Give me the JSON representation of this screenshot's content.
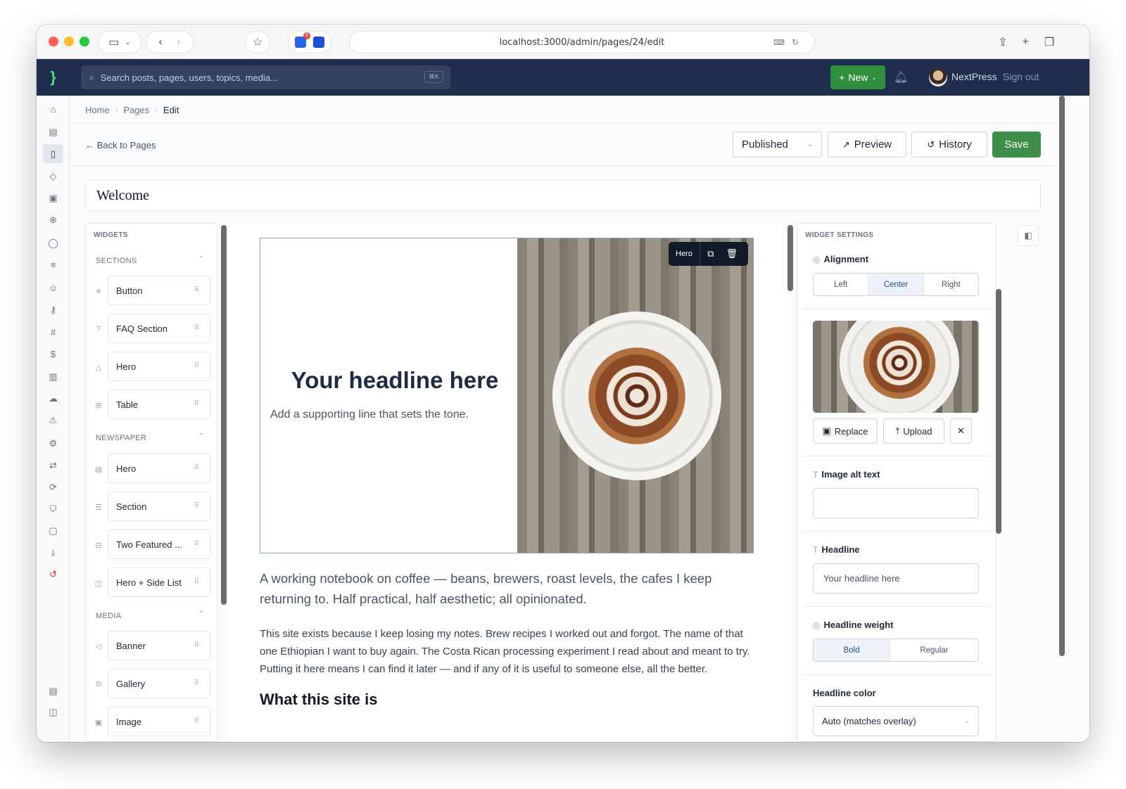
{
  "browser": {
    "url": "localhost:3000/admin/pages/24/edit",
    "badge_count": "6"
  },
  "topnav": {
    "logo": "}",
    "search_placeholder": "Search posts, pages, users, topics, media...",
    "search_shortcut": "⌘K",
    "new_label": "New",
    "user_name": "NextPress",
    "sign_out": "Sign out"
  },
  "breadcrumb": {
    "home": "Home",
    "pages": "Pages",
    "current": "Edit"
  },
  "toolbar": {
    "back_label": "Back to Pages",
    "status": "Published",
    "preview": "Preview",
    "history": "History",
    "save": "Save"
  },
  "page_title": "Welcome",
  "widgets": {
    "heading": "WIDGETS",
    "groups": [
      {
        "name": "SECTIONS",
        "items": [
          "Button",
          "FAQ Section",
          "Hero",
          "Table"
        ]
      },
      {
        "name": "NEWSPAPER",
        "items": [
          "Hero",
          "Section",
          "Two Featured ...",
          "Hero + Side List"
        ]
      },
      {
        "name": "MEDIA",
        "items": [
          "Banner",
          "Gallery",
          "Image"
        ]
      }
    ]
  },
  "canvas": {
    "hero_toolbar_label": "Hero",
    "hero_headline": "Your headline here",
    "hero_subline": "Add a supporting line that sets the tone.",
    "lead": "A working notebook on coffee — beans, brewers, roast levels, the cafes I keep returning to. Half practical, half aesthetic; all opinionated.",
    "body": "This site exists because I keep losing my notes. Brew recipes I worked out and forgot. The name of that one Ethiopian I want to buy again. The Costa Rican processing experiment I read about and meant to try. Putting it here means I can find it later — and if any of it is useful to someone else, all the better.",
    "heading_2": "What this site is"
  },
  "settings": {
    "heading": "WIDGET SETTINGS",
    "alignment_label": "Alignment",
    "alignment_options": [
      "Left",
      "Center",
      "Right"
    ],
    "alignment_selected": "Center",
    "replace": "Replace",
    "upload": "Upload",
    "alt_label": "Image alt text",
    "alt_value": "",
    "headline_label": "Headline",
    "headline_value": "Your headline here",
    "weight_label": "Headline weight",
    "weight_options": [
      "Bold",
      "Regular"
    ],
    "weight_selected": "Bold",
    "color_label": "Headline color",
    "color_value": "Auto (matches overlay)"
  },
  "colors": {
    "nav_bg": "#1f2d4e",
    "accent_green": "#3f8f4b",
    "selection_blue": "#8aa7d6"
  }
}
